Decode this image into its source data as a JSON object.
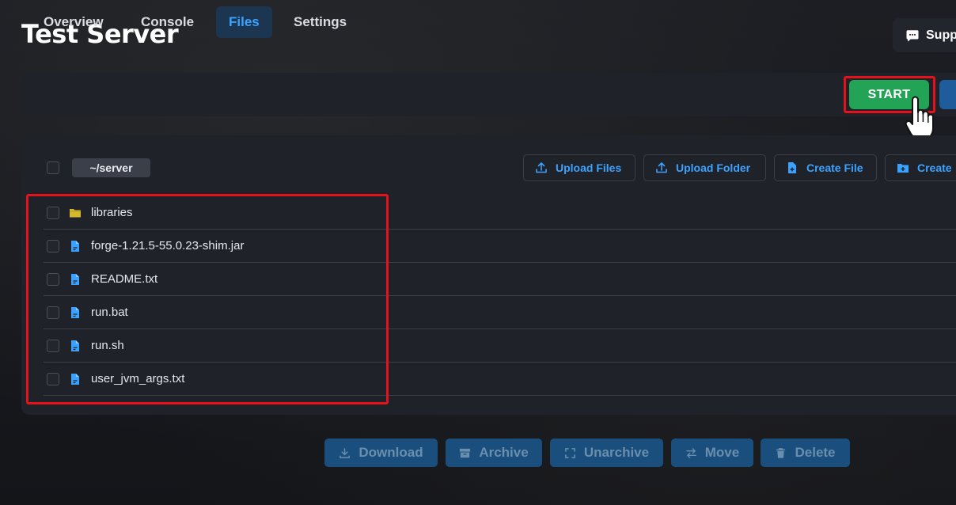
{
  "header": {
    "title": "Test Server",
    "support_label": "Supp"
  },
  "tabs": [
    {
      "label": "Overview",
      "active": false
    },
    {
      "label": "Console",
      "active": false
    },
    {
      "label": "Files",
      "active": true
    },
    {
      "label": "Settings",
      "active": false
    }
  ],
  "power": {
    "start_label": "START"
  },
  "files": {
    "current_path": "~/server",
    "actions": {
      "upload_files": "Upload Files",
      "upload_folder": "Upload Folder",
      "create_file": "Create File",
      "create_folder": "Create"
    },
    "entries": [
      {
        "name": "libraries",
        "type": "folder",
        "icon": "folder-icon"
      },
      {
        "name": "forge-1.21.5-55.0.23-shim.jar",
        "type": "file",
        "icon": "file-icon"
      },
      {
        "name": "README.txt",
        "type": "file",
        "icon": "file-icon"
      },
      {
        "name": "run.bat",
        "type": "file",
        "icon": "file-icon"
      },
      {
        "name": "run.sh",
        "type": "file",
        "icon": "file-icon"
      },
      {
        "name": "user_jvm_args.txt",
        "type": "file",
        "icon": "file-icon"
      }
    ],
    "bulk_actions": {
      "download": "Download",
      "archive": "Archive",
      "unarchive": "Unarchive",
      "move": "Move",
      "delete": "Delete"
    }
  },
  "colors": {
    "accent": "#3ba3ff",
    "start": "#22a356",
    "folder": "#d4b72c",
    "highlight": "#e6121b"
  }
}
